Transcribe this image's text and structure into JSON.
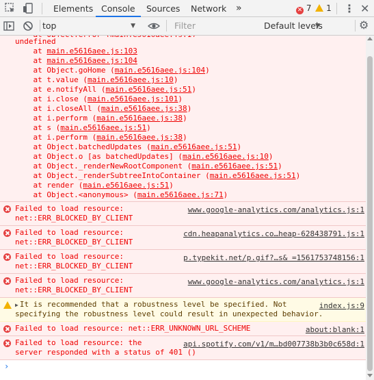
{
  "tabs": {
    "items": [
      "Elements",
      "Console",
      "Sources",
      "Network"
    ],
    "active": "Console",
    "more_glyph": "»"
  },
  "counts": {
    "errors": "7",
    "warnings": "1"
  },
  "toolbar": {
    "context": "top",
    "filter_placeholder": "Filter",
    "levels": "Default levels"
  },
  "stack": {
    "first": "undefined",
    "frames": [
      {
        "prefix": "    at ",
        "fn": "",
        "loc": "main.e5616aee.js:103"
      },
      {
        "prefix": "    at ",
        "fn": "",
        "loc": "main.e5616aee.js:104"
      },
      {
        "prefix": "    at ",
        "fn": "Object.goHome",
        "loc": "main.e5616aee.js:104"
      },
      {
        "prefix": "    at ",
        "fn": "t.value",
        "loc": "main.e5616aee.js:10"
      },
      {
        "prefix": "    at ",
        "fn": "e.notifyAll",
        "loc": "main.e5616aee.js:51"
      },
      {
        "prefix": "    at ",
        "fn": "i.close",
        "loc": "main.e5616aee.js:101"
      },
      {
        "prefix": "    at ",
        "fn": "i.closeAll",
        "loc": "main.e5616aee.js:38"
      },
      {
        "prefix": "    at ",
        "fn": "i.perform",
        "loc": "main.e5616aee.js:38"
      },
      {
        "prefix": "    at ",
        "fn": "s",
        "loc": "main.e5616aee.js:51"
      },
      {
        "prefix": "    at ",
        "fn": "i.perform",
        "loc": "main.e5616aee.js:38"
      },
      {
        "prefix": "    at ",
        "fn": "Object.batchedUpdates",
        "loc": "main.e5616aee.js:51"
      },
      {
        "prefix": "    at ",
        "fn": "Object.o [as batchedUpdates]",
        "loc": "main.e5616aee.js:10"
      },
      {
        "prefix": "    at ",
        "fn": "Object._renderNewRootComponent",
        "loc": "main.e5616aee.js:51"
      },
      {
        "prefix": "    at ",
        "fn": "Object._renderSubtreeIntoContainer",
        "loc": "main.e5616aee.js:51"
      },
      {
        "prefix": "    at ",
        "fn": "render",
        "loc": "main.e5616aee.js:51"
      },
      {
        "prefix": "    at ",
        "fn": "Object.<anonymous>",
        "loc": "main.e5616aee.js:71"
      }
    ]
  },
  "messages": [
    {
      "level": "error",
      "lines": [
        "Failed to load resource:",
        "net::ERR_BLOCKED_BY_CLIENT"
      ],
      "source": "www.google-analytics.com/analytics.js:1"
    },
    {
      "level": "error",
      "lines": [
        "Failed to load resource:",
        "net::ERR_BLOCKED_BY_CLIENT"
      ],
      "source": "cdn.heapanalytics.co…heap-628438791.js:1"
    },
    {
      "level": "error",
      "lines": [
        "Failed to load resource:",
        "net::ERR_BLOCKED_BY_CLIENT"
      ],
      "source": "p.typekit.net/p.gif?…s& =1561753748156:1"
    },
    {
      "level": "error",
      "lines": [
        "Failed to load resource:",
        "net::ERR_BLOCKED_BY_CLIENT"
      ],
      "source": "www.google-analytics.com/analytics.js:1"
    },
    {
      "level": "warning",
      "lines": [
        "It is recommended that a robustness level be specified. Not",
        "specifying the robustness level could result in unexpected behavior."
      ],
      "source": "index.js:9"
    },
    {
      "level": "error",
      "lines": [
        "Failed to load resource: net::ERR_UNKNOWN_URL_SCHEME"
      ],
      "source": "about:blank:1"
    },
    {
      "level": "error",
      "lines": [
        "Failed to load resource: the",
        "server responded with a status of 401 ()"
      ],
      "source": "api.spotify.com/v1/m…bd007738b3b0c658d:1"
    }
  ],
  "prompt_glyph": "›"
}
